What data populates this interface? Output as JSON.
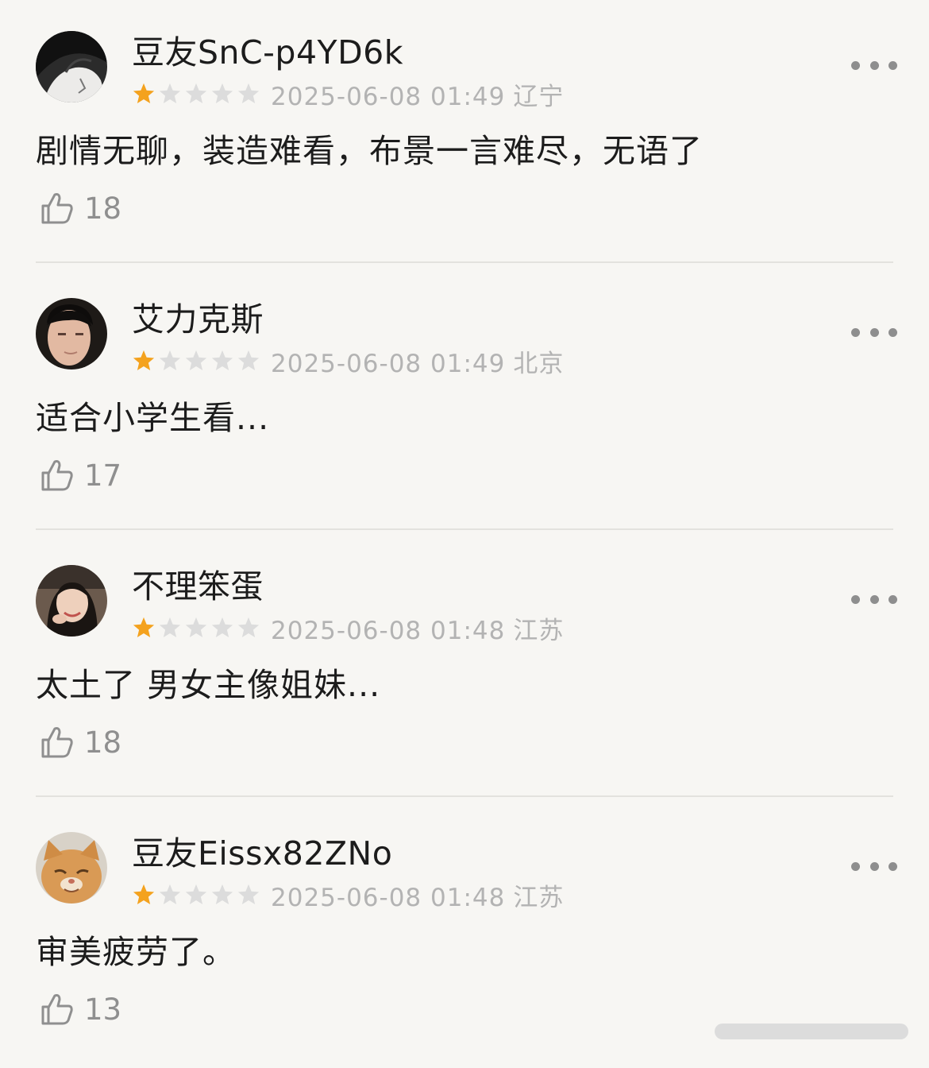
{
  "reviews": [
    {
      "username": "豆友SnC-p4YD6k",
      "rating": 1,
      "max_rating": 5,
      "datetime": "2025-06-08 01:49",
      "location": "辽宁",
      "comment": "剧情无聊，装造难看，布景一言难尽，无语了",
      "likes": "18",
      "avatar": "dark-anime-figure"
    },
    {
      "username": "艾力克斯",
      "rating": 1,
      "max_rating": 5,
      "datetime": "2025-06-08 01:49",
      "location": "北京",
      "comment": "适合小学生看...",
      "likes": "17",
      "avatar": "young-man-portrait"
    },
    {
      "username": "不理笨蛋",
      "rating": 1,
      "max_rating": 5,
      "datetime": "2025-06-08 01:48",
      "location": "江苏",
      "comment": "太土了 男女主像姐妹...",
      "likes": "18",
      "avatar": "smiling-woman-portrait"
    },
    {
      "username": "豆友Eissx82ZNo",
      "rating": 1,
      "max_rating": 5,
      "datetime": "2025-06-08 01:48",
      "location": "江苏",
      "comment": "审美疲劳了。",
      "likes": "13",
      "avatar": "orange-cat-photo"
    }
  ],
  "icons": {
    "like": "thumbs-up-icon",
    "more": "more-options-icon",
    "star": "star-icon"
  },
  "colors": {
    "star_on": "#f4a21e",
    "star_off": "#dcdcdc",
    "meta_text": "#b3b3b3",
    "background": "#f7f6f3"
  }
}
